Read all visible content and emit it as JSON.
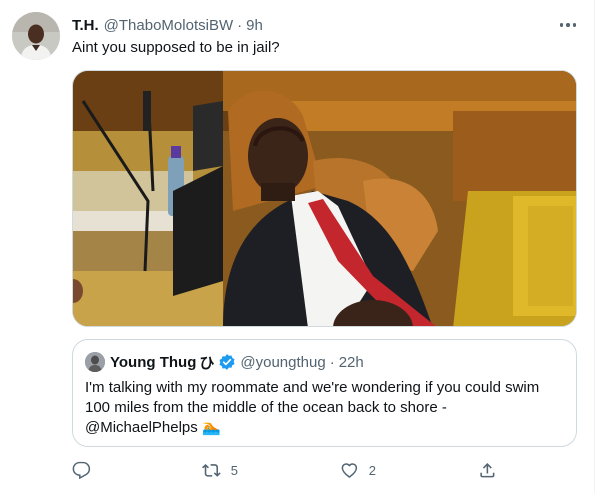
{
  "tweet": {
    "author_name": "T.H.",
    "handle": "@ThaboMolotsiBW",
    "separator": "·",
    "time": "9h",
    "text": "Aint you supposed to be in jail?",
    "more_icon": "ellipsis-icon"
  },
  "quoted": {
    "author_name": "Young Thug",
    "name_symbol": "ひ",
    "verified_icon": "verified-badge-icon",
    "handle": "@youngthug",
    "separator": "·",
    "time": "22h",
    "text": "I'm talking with my roommate and we're wondering if you could swim 100 miles from the middle of the ocean back to shore -",
    "mention": "@MichaelPhelps",
    "emoji": "🏊"
  },
  "actions": {
    "reply": {
      "icon": "reply-icon",
      "count": ""
    },
    "retweet": {
      "icon": "retweet-icon",
      "count": "5"
    },
    "like": {
      "icon": "heart-icon",
      "count": "2"
    },
    "share": {
      "icon": "share-icon",
      "count": ""
    }
  },
  "colors": {
    "text_primary": "#0f1419",
    "text_secondary": "#536471",
    "border": "#cfd9de",
    "verified_blue": "#1d9bf0"
  }
}
